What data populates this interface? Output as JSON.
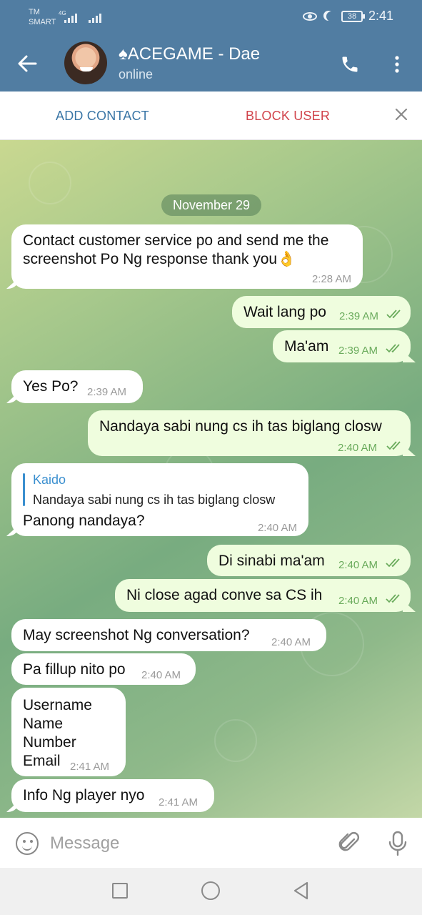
{
  "status_bar": {
    "carrier": "TM",
    "carrier2": "SMART",
    "network": "4G",
    "battery": "38",
    "time": "2:41"
  },
  "header": {
    "title": "♠ACEGAME - Dae",
    "status": "online",
    "back_icon": "arrow-left-icon",
    "call_icon": "phone-icon",
    "menu_icon": "more-vertical-icon"
  },
  "action_bar": {
    "add_contact": "ADD CONTACT",
    "block_user": "BLOCK USER",
    "close_icon": "close-icon",
    "block_color": "#d1444c",
    "add_color": "#3a76a6"
  },
  "date_separator": "November 29",
  "messages": [
    {
      "dir": "in",
      "lines": [
        "Contact customer service po and send me the",
        "screenshot Po Ng response thank you👌"
      ],
      "time": "2:28 AM"
    },
    {
      "dir": "out",
      "text": "Wait lang po",
      "time": "2:39 AM",
      "read": true
    },
    {
      "dir": "out",
      "text": "Ma'am",
      "time": "2:39 AM",
      "read": true
    },
    {
      "dir": "in",
      "text": "Yes Po?",
      "time": "2:39 AM"
    },
    {
      "dir": "out",
      "text": "Nandaya sabi nung cs ih tas biglang closw",
      "time": "2:40 AM",
      "read": true
    },
    {
      "dir": "in",
      "reply_name": "Kaido",
      "reply_text": "Nandaya sabi nung cs ih tas biglang closw",
      "text": "Panong nandaya?",
      "time": "2:40 AM"
    },
    {
      "dir": "out",
      "text": "Di sinabi ma'am",
      "time": "2:40 AM",
      "read": true
    },
    {
      "dir": "out",
      "text": "Ni close agad conve sa CS ih",
      "time": "2:40 AM",
      "read": true
    },
    {
      "dir": "in",
      "text": "May screenshot Ng conversation?",
      "time": "2:40 AM"
    },
    {
      "dir": "in",
      "text": "Pa fillup nito po",
      "time": "2:40 AM"
    },
    {
      "dir": "in",
      "lines": [
        "Username",
        "Name",
        "Number",
        "Email"
      ],
      "time": "2:41 AM"
    },
    {
      "dir": "in",
      "text": "Info Ng player nyo",
      "time": "2:41 AM"
    }
  ],
  "composer": {
    "placeholder": "Message",
    "emoji_icon": "smiley-icon",
    "attach_icon": "paperclip-icon",
    "mic_icon": "microphone-icon"
  },
  "colors": {
    "header_bg": "#517da2",
    "outgoing_bubble": "#effdde",
    "incoming_bubble": "#ffffff",
    "read_ticks": "#6aab5c"
  }
}
